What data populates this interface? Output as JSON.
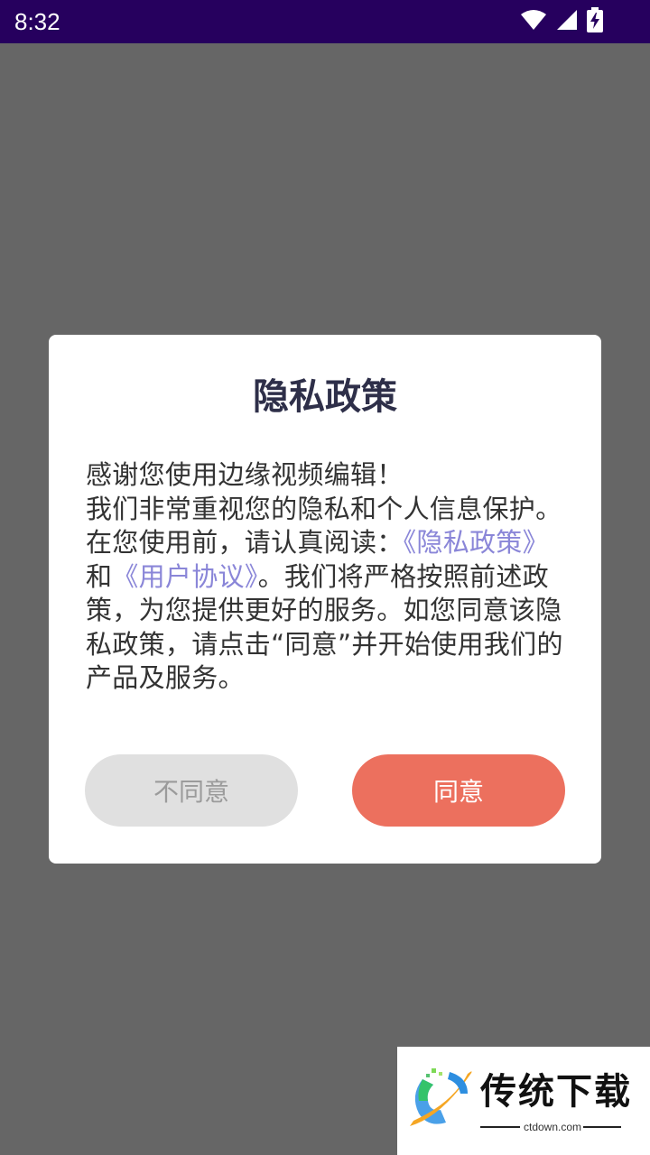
{
  "status_bar": {
    "time": "8:32",
    "icons": [
      "wifi-icon",
      "cell-signal-icon",
      "battery-charging-icon"
    ]
  },
  "dialog": {
    "title": "隐私政策",
    "body": {
      "line1": "感谢您使用边缘视频编辑！",
      "text_before": "我们非常重视您的隐私和个人信息保护。在您使用前，请认真阅读：",
      "privacy_link": "《隐私政策》",
      "and": "和",
      "terms_link": "《用户协议》",
      "text_after": "。我们将严格按照前述政策，为您提供更好的服务。如您同意该隐私政策，请点击“同意”并开始使用我们的产品及服务。"
    },
    "disagree_label": "不同意",
    "agree_label": "同意"
  },
  "watermark": {
    "title": "传统下载",
    "subtitle": "ctdown.com"
  },
  "colors": {
    "status_bar": "#26005e",
    "overlay": "#666666",
    "agree_button": "#ec705e",
    "disagree_button": "#e0e0e0",
    "link": "#8a86d8",
    "title": "#2e2f49"
  }
}
